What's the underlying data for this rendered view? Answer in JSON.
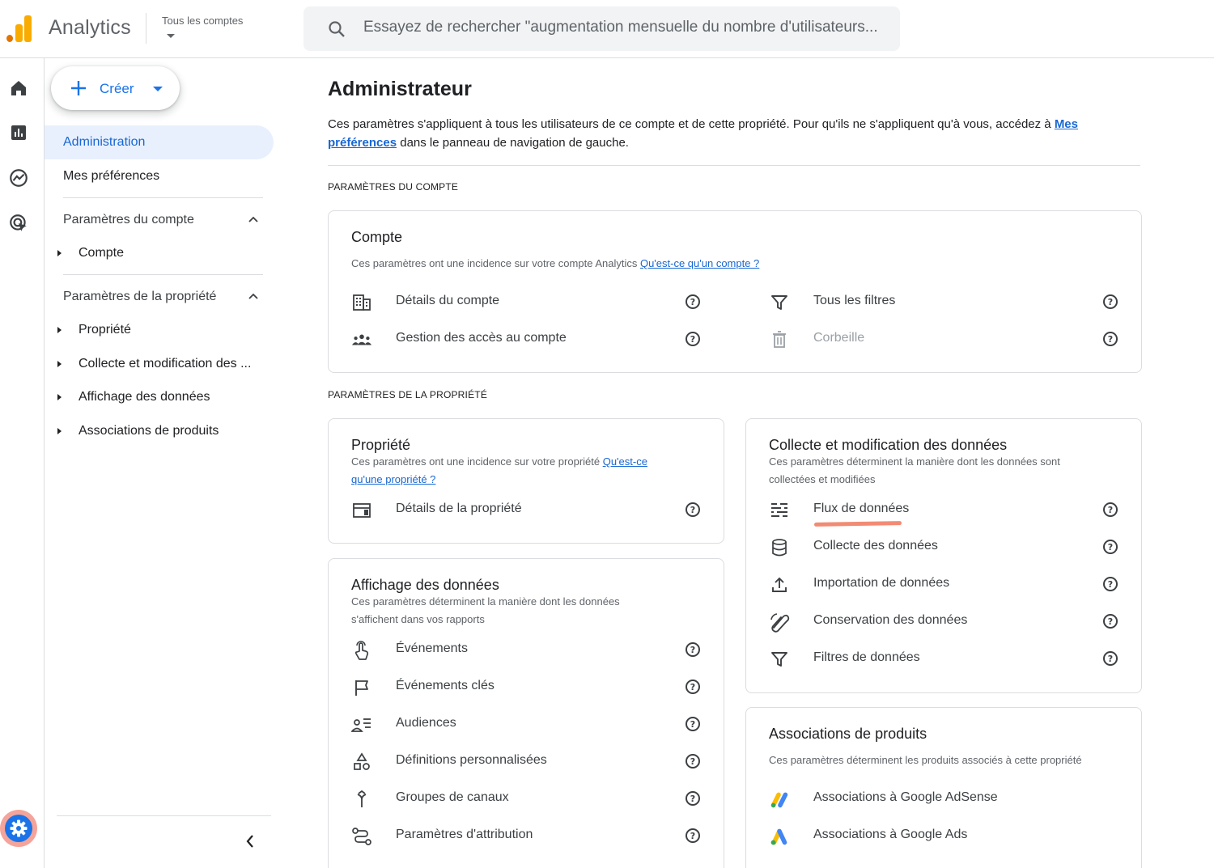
{
  "header": {
    "app_name": "Analytics",
    "account_picker_label": "Tous les comptes",
    "search_placeholder": "Essayez de rechercher \"augmentation mensuelle du nombre d'utilisateurs..."
  },
  "rail": {
    "items": [
      "home-icon",
      "reports-icon",
      "explore-icon",
      "advertising-icon"
    ],
    "settings": "settings-icon"
  },
  "nav": {
    "create_label": "Créer",
    "items": [
      {
        "label": "Administration",
        "active": true
      },
      {
        "label": "Mes préférences",
        "active": false
      }
    ],
    "sections": [
      {
        "label": "Paramètres du compte",
        "children": [
          "Compte"
        ]
      },
      {
        "label": "Paramètres de la propriété",
        "children": [
          "Propriété",
          "Collecte et modification des ...",
          "Affichage des données",
          "Associations de produits"
        ]
      }
    ]
  },
  "main": {
    "title": "Administrateur",
    "intro_text": "Ces paramètres s'appliquent à tous les utilisateurs de ce compte et de cette propriété. Pour qu'ils ne s'appliquent qu'à vous, accédez à ",
    "intro_link_1": "Mes",
    "intro_link_2": "préférences",
    "intro_tail": " dans le panneau de navigation de gauche.",
    "account_section_label": "PARAMÈTRES DU COMPTE",
    "property_section_label": "PARAMÈTRES DE LA PROPRIÉTÉ",
    "account_card": {
      "title": "Compte",
      "desc": "Ces paramètres ont une incidence sur votre compte Analytics ",
      "link": "Qu'est-ce qu'un compte ?",
      "rows": [
        {
          "label": "Détails du compte",
          "icon": "building-icon"
        },
        {
          "label": "Gestion des accès au compte",
          "icon": "people-icon"
        },
        {
          "label": "Tous les filtres",
          "icon": "filter-icon"
        },
        {
          "label": "Corbeille",
          "icon": "trash-icon"
        }
      ]
    },
    "property_card": {
      "title": "Propriété",
      "desc": "Ces paramètres ont une incidence sur votre propriété ",
      "link_1": "Qu'est-ce",
      "link_2": "qu'une propriété ?",
      "rows": [
        {
          "label": "Détails de la propriété",
          "icon": "property-details-icon"
        }
      ]
    },
    "display_card": {
      "title": "Affichage des données",
      "desc_1": "Ces paramètres déterminent la manière dont les données",
      "desc_2": "s'affichent dans vos rapports",
      "rows": [
        {
          "label": "Événements",
          "icon": "touch-icon"
        },
        {
          "label": "Événements clés",
          "icon": "flag-icon"
        },
        {
          "label": "Audiences",
          "icon": "audience-icon"
        },
        {
          "label": "Définitions personnalisées",
          "icon": "shapes-icon"
        },
        {
          "label": "Groupes de canaux",
          "icon": "merge-icon"
        },
        {
          "label": "Paramètres d'attribution",
          "icon": "route-icon"
        }
      ]
    },
    "collection_card": {
      "title": "Collecte et modification des données",
      "desc_1": "Ces paramètres déterminent la manière dont les données sont",
      "desc_2": "collectées et modifiées",
      "rows": [
        {
          "label": "Flux de données",
          "icon": "stream-icon"
        },
        {
          "label": "Collecte des données",
          "icon": "database-icon"
        },
        {
          "label": "Importation de données",
          "icon": "upload-icon"
        },
        {
          "label": "Conservation des données",
          "icon": "retention-icon"
        },
        {
          "label": "Filtres de données",
          "icon": "filter-icon"
        }
      ]
    },
    "products_card": {
      "title": "Associations de produits",
      "desc": "Ces paramètres déterminent les produits associés à cette propriété",
      "rows": [
        {
          "label": "Associations à Google AdSense",
          "icon": "adsense-icon"
        },
        {
          "label": "Associations à Google Ads",
          "icon": "google-ads-icon"
        }
      ]
    }
  },
  "colors": {
    "accent": "#1a73e8",
    "active_bg": "#e8f0fe",
    "highlight": "#f28b74",
    "logo_orange": "#f9ab00",
    "logo_dark_orange": "#e37400"
  }
}
